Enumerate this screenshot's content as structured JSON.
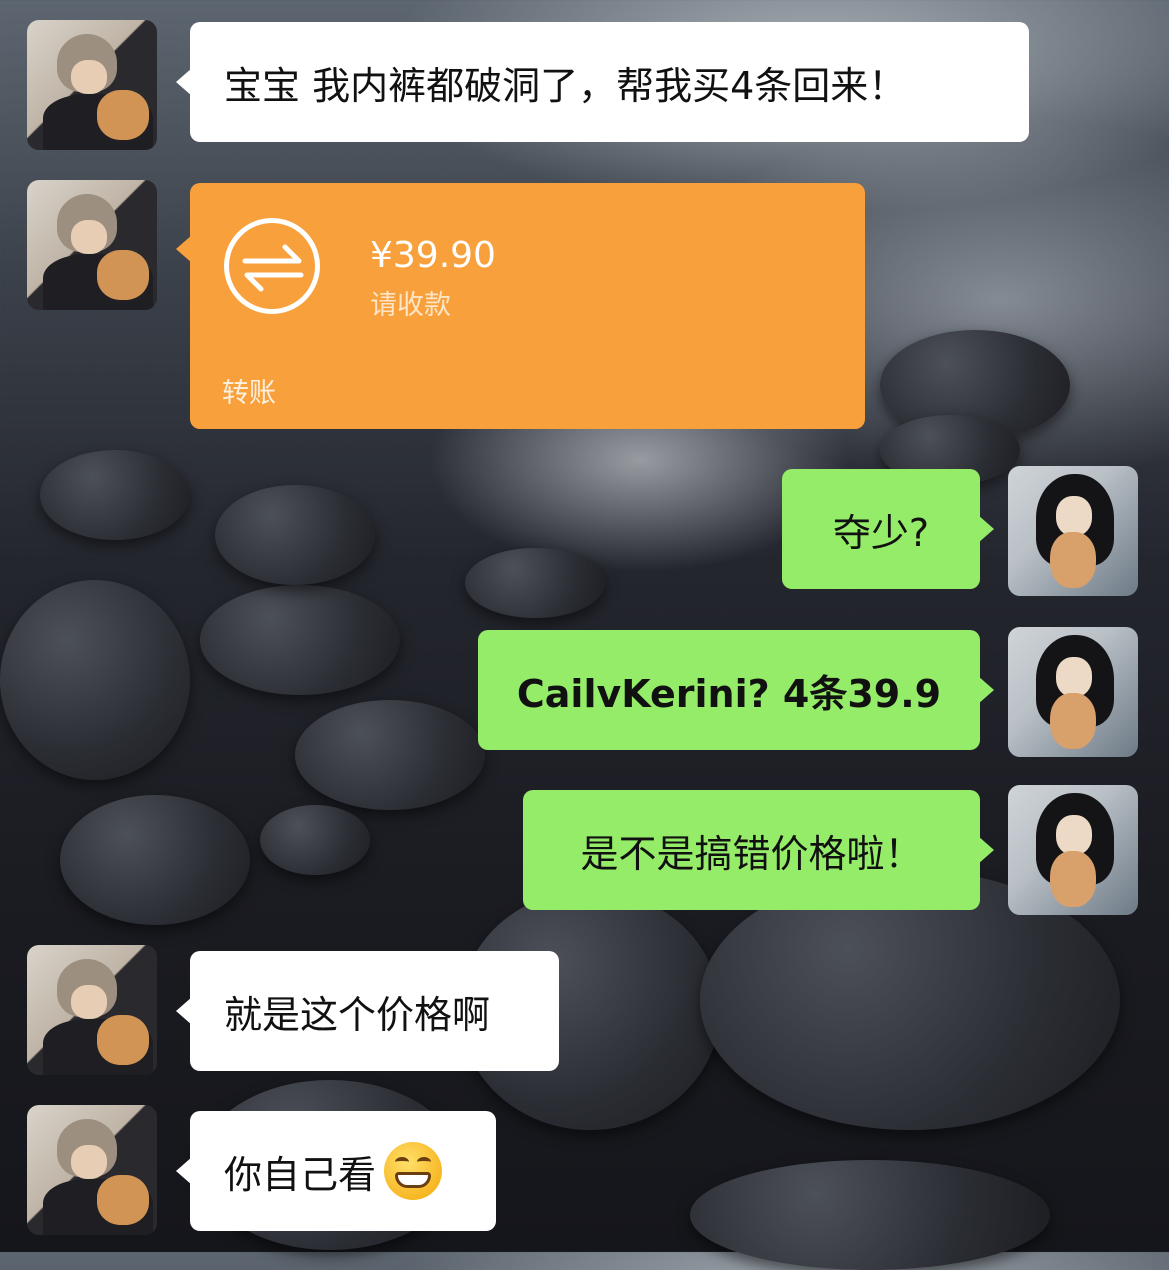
{
  "messages": [
    {
      "side": "left",
      "avatar": "contact-avatar",
      "text": "宝宝 我内裤都破洞了，帮我买4条回来！"
    },
    {
      "side": "left",
      "avatar": "contact-avatar",
      "type": "transfer",
      "transfer": {
        "amount": "¥39.90",
        "subtitle": "请收款",
        "footer": "转账",
        "icon": "transfer-arrows-icon"
      }
    },
    {
      "side": "right",
      "avatar": "my-avatar",
      "text": "夺少?"
    },
    {
      "side": "right",
      "avatar": "my-avatar",
      "text": "CailvKerini?  4条39.9"
    },
    {
      "side": "right",
      "avatar": "my-avatar",
      "text": "是不是搞错价格啦！"
    },
    {
      "side": "left",
      "avatar": "contact-avatar",
      "text": "就是这个价格啊"
    },
    {
      "side": "left",
      "avatar": "contact-avatar",
      "text": "你自己看",
      "emoji": "grinning-squint-emoji"
    }
  ],
  "colors": {
    "left_bubble": "#ffffff",
    "right_bubble": "#95ec69",
    "transfer_card": "#f8a03b"
  }
}
